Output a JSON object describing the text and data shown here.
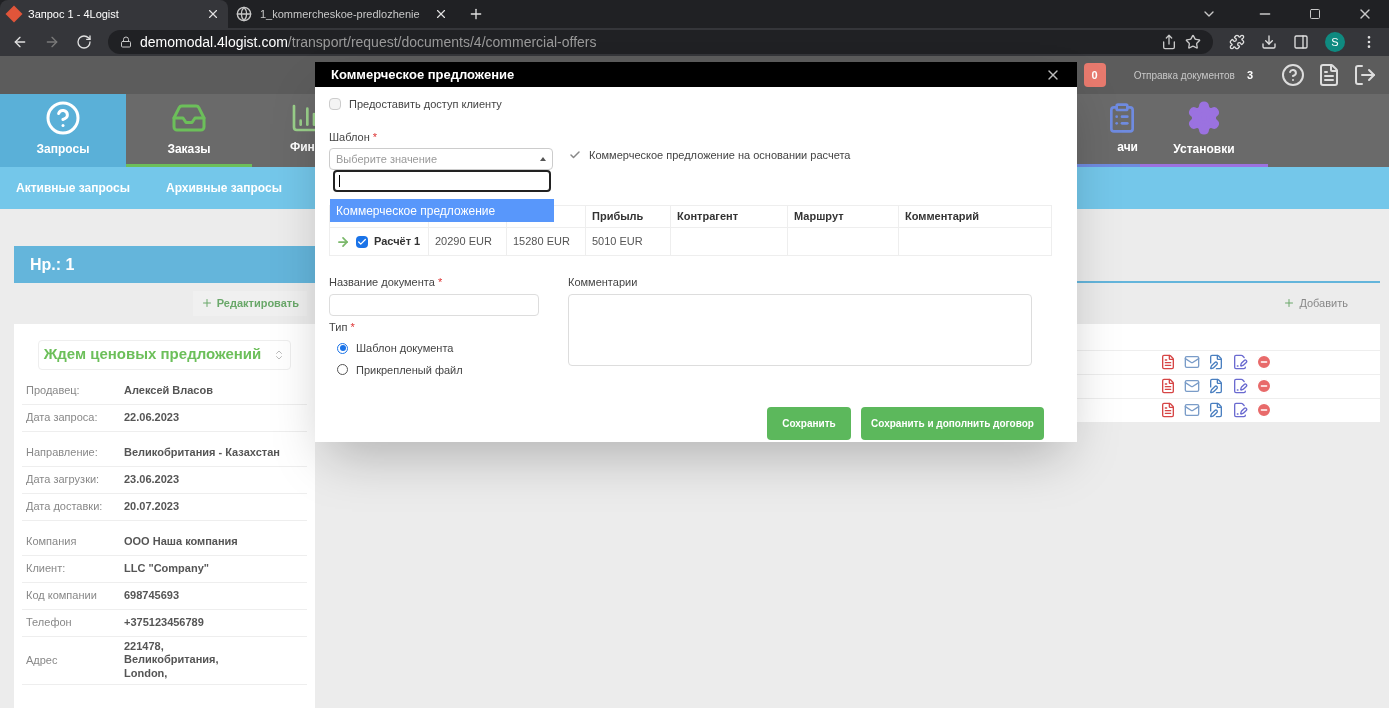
{
  "browser": {
    "tabs": [
      {
        "title": "Запрос 1 - 4Logist",
        "selected": true,
        "kind": "logo"
      },
      {
        "title": "1_kommercheskoe-predlozhenie",
        "selected": false,
        "kind": "globe"
      }
    ],
    "url": {
      "host": "demomodal.4logist.com",
      "path": "/transport/request/documents/4/commercial-offers"
    },
    "profile": "S"
  },
  "header": {
    "badge": "0",
    "sending_label": "Отправка документов",
    "sending_count": "3"
  },
  "nav": [
    {
      "label": "Запросы",
      "selected": true,
      "kind": "help",
      "color": "#5ab0d8"
    },
    {
      "label": "Заказы",
      "selected": false,
      "kind": "inbox",
      "color": "#6cbf5a"
    },
    {
      "label": "Фин",
      "selected": false,
      "kind": "partial-left",
      "color": "#6a6a6a"
    },
    {
      "label": "ачи",
      "selected": false,
      "kind": "partial-right",
      "color": "#6f8be0"
    },
    {
      "label": "Установки",
      "selected": false,
      "kind": "gear",
      "color": "#9b72e0"
    }
  ],
  "subnav": [
    "Активные запросы",
    "Архивные запросы"
  ],
  "request": {
    "title": "Нр.: 1",
    "edit": "Редактировать",
    "status": "Ждем ценовых предложений",
    "groups": [
      [
        {
          "label": "Продавец:",
          "value": "Алексей Власов"
        },
        {
          "label": "Дата запроса:",
          "value": "22.06.2023"
        }
      ],
      [
        {
          "label": "Направление:",
          "value": "Великобритания - Казахстан"
        },
        {
          "label": "Дата загрузки:",
          "value": "23.06.2023"
        },
        {
          "label": "Дата доставки:",
          "value": "20.07.2023"
        }
      ],
      [
        {
          "label": "Компания",
          "value": "ООО Наша компания"
        },
        {
          "label": "Клиент:",
          "value": "LLC \"Company\""
        },
        {
          "label": "Код компании",
          "value": "698745693"
        },
        {
          "label": "Телефон",
          "value": "+375123456789"
        },
        {
          "label": "Адрес",
          "value": "221478,\nВеликобритания,\nLondon,"
        }
      ]
    ]
  },
  "documents": {
    "add": "Добавить",
    "rows": [
      {
        "actions": [
          {
            "kind": "pdf"
          },
          {
            "kind": "mail"
          },
          {
            "kind": "edit"
          },
          {
            "kind": "sign"
          },
          {
            "kind": "delete"
          }
        ]
      },
      {
        "actions": [
          {
            "kind": "pdf"
          },
          {
            "kind": "mail"
          },
          {
            "kind": "edit"
          },
          {
            "kind": "sign"
          },
          {
            "kind": "delete"
          }
        ]
      },
      {
        "actions": [
          {
            "kind": "pdf"
          },
          {
            "kind": "mail"
          },
          {
            "kind": "edit"
          },
          {
            "kind": "sign"
          },
          {
            "kind": "delete"
          }
        ]
      }
    ]
  },
  "modal": {
    "title": "Коммерческое предложение",
    "share": {
      "label": "Предоставить доступ клиенту",
      "checked": false
    },
    "template": {
      "label": "Шаблон",
      "required_mark": "*",
      "placeholder": "Выберите значение",
      "expanded": true,
      "options": [
        {
          "label": "Коммерческое предложение",
          "selected": true
        }
      ]
    },
    "based_on_calc": {
      "label": "Коммерческое предложение на основании расчета",
      "checked": true
    },
    "table": {
      "columns": [
        "",
        "",
        "",
        "Прибыль",
        "Контрагент",
        "Маршрут",
        "Комментарий"
      ],
      "rows": [
        {
          "checked": true,
          "cells": [
            "Расчёт 1",
            "20290 EUR",
            "15280 EUR",
            "5010 EUR"
          ]
        }
      ]
    },
    "doc_name": {
      "label": "Название документа",
      "required_mark": "*"
    },
    "comments": {
      "label": "Комментарии"
    },
    "type": {
      "label": "Тип",
      "required_mark": "*",
      "options": [
        {
          "label": "Шаблон документа",
          "selected": true
        },
        {
          "label": "Прикрепленый файл",
          "selected": false
        }
      ]
    },
    "buttons": [
      "Сохранить",
      "Сохранить и дополнить договор"
    ]
  }
}
